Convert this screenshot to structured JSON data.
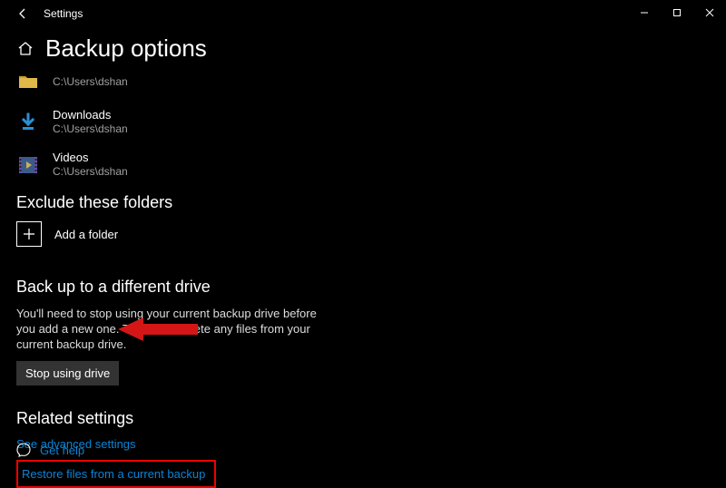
{
  "window": {
    "title": "Settings"
  },
  "page": {
    "title": "Backup options"
  },
  "folders": [
    {
      "name": "",
      "path": "C:\\Users\\dshan",
      "icon": "folder"
    },
    {
      "name": "Downloads",
      "path": "C:\\Users\\dshan",
      "icon": "download"
    },
    {
      "name": "Videos",
      "path": "C:\\Users\\dshan",
      "icon": "video"
    }
  ],
  "exclude": {
    "heading": "Exclude these folders",
    "add_label": "Add a folder"
  },
  "different_drive": {
    "heading": "Back up to a different drive",
    "description": "You'll need to stop using your current backup drive before you add a new one. This won't delete any files from your current backup drive.",
    "button": "Stop using drive"
  },
  "related": {
    "heading": "Related settings",
    "advanced_link": "See advanced settings",
    "restore_link": "Restore files from a current backup"
  },
  "help": {
    "label": "Get help"
  }
}
